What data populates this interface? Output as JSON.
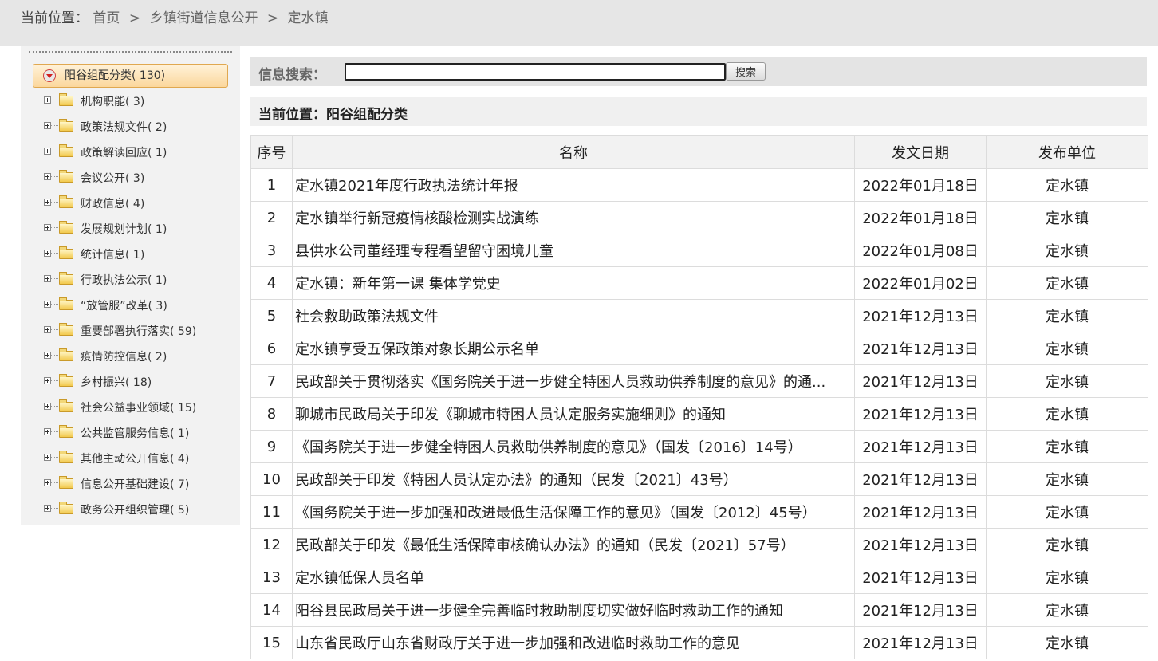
{
  "breadcrumb": {
    "prefix": "当前位置：",
    "items": [
      "首页",
      "乡镇街道信息公开",
      "定水镇"
    ],
    "separator": ">"
  },
  "sidebar": {
    "root": {
      "label": "阳谷组配分类",
      "count": "( 130)"
    },
    "items": [
      {
        "label": "机构职能",
        "count": "( 3)"
      },
      {
        "label": "政策法规文件",
        "count": "( 2)"
      },
      {
        "label": "政策解读回应",
        "count": "( 1)"
      },
      {
        "label": "会议公开",
        "count": "( 3)"
      },
      {
        "label": "财政信息",
        "count": "( 4)"
      },
      {
        "label": "发展规划计划",
        "count": "( 1)"
      },
      {
        "label": "统计信息",
        "count": "( 1)"
      },
      {
        "label": "行政执法公示",
        "count": "( 1)"
      },
      {
        "label": "“放管服”改革",
        "count": "( 3)"
      },
      {
        "label": "重要部署执行落实",
        "count": "( 59)"
      },
      {
        "label": "疫情防控信息",
        "count": "( 2)"
      },
      {
        "label": "乡村振兴",
        "count": "( 18)"
      },
      {
        "label": "社会公益事业领域",
        "count": "( 15)"
      },
      {
        "label": "公共监管服务信息",
        "count": "( 1)"
      },
      {
        "label": "其他主动公开信息",
        "count": "( 4)"
      },
      {
        "label": "信息公开基础建设",
        "count": "( 7)"
      },
      {
        "label": "政务公开组织管理",
        "count": "( 5)"
      }
    ]
  },
  "search": {
    "label": "信息搜索：",
    "value": "",
    "button": "搜索"
  },
  "location": {
    "text": "当前位置：阳谷组配分类"
  },
  "table": {
    "headers": [
      "序号",
      "名称",
      "发文日期",
      "发布单位"
    ],
    "rows": [
      {
        "idx": "1",
        "name": "定水镇2021年度行政执法统计年报",
        "date": "2022年01月18日",
        "unit": "定水镇"
      },
      {
        "idx": "2",
        "name": "定水镇举行新冠疫情核酸检测实战演练",
        "date": "2022年01月18日",
        "unit": "定水镇"
      },
      {
        "idx": "3",
        "name": "县供水公司董经理专程看望留守困境儿童",
        "date": "2022年01月08日",
        "unit": "定水镇"
      },
      {
        "idx": "4",
        "name": "定水镇：新年第一课 集体学党史",
        "date": "2022年01月02日",
        "unit": "定水镇"
      },
      {
        "idx": "5",
        "name": "社会救助政策法规文件",
        "date": "2021年12月13日",
        "unit": "定水镇"
      },
      {
        "idx": "6",
        "name": "定水镇享受五保政策对象长期公示名单",
        "date": "2021年12月13日",
        "unit": "定水镇"
      },
      {
        "idx": "7",
        "name": "民政部关于贯彻落实《国务院关于进一步健全特困人员救助供养制度的意见》的通...",
        "date": "2021年12月13日",
        "unit": "定水镇"
      },
      {
        "idx": "8",
        "name": "聊城市民政局关于印发《聊城市特困人员认定服务实施细则》的通知",
        "date": "2021年12月13日",
        "unit": "定水镇"
      },
      {
        "idx": "9",
        "name": "《国务院关于进一步健全特困人员救助供养制度的意见》（国发〔2016〕14号）",
        "date": "2021年12月13日",
        "unit": "定水镇"
      },
      {
        "idx": "10",
        "name": "民政部关于印发《特困人员认定办法》的通知（民发〔2021〕43号）",
        "date": "2021年12月13日",
        "unit": "定水镇"
      },
      {
        "idx": "11",
        "name": "《国务院关于进一步加强和改进最低生活保障工作的意见》（国发〔2012〕45号）",
        "date": "2021年12月13日",
        "unit": "定水镇"
      },
      {
        "idx": "12",
        "name": "民政部关于印发《最低生活保障审核确认办法》的通知（民发〔2021〕57号）",
        "date": "2021年12月13日",
        "unit": "定水镇"
      },
      {
        "idx": "13",
        "name": "定水镇低保人员名单",
        "date": "2021年12月13日",
        "unit": "定水镇"
      },
      {
        "idx": "14",
        "name": "阳谷县民政局关于进一步健全完善临时救助制度切实做好临时救助工作的通知",
        "date": "2021年12月13日",
        "unit": "定水镇"
      },
      {
        "idx": "15",
        "name": "山东省民政厅山东省财政厅关于进一步加强和改进临时救助工作的意见",
        "date": "2021年12月13日",
        "unit": "定水镇"
      }
    ]
  }
}
